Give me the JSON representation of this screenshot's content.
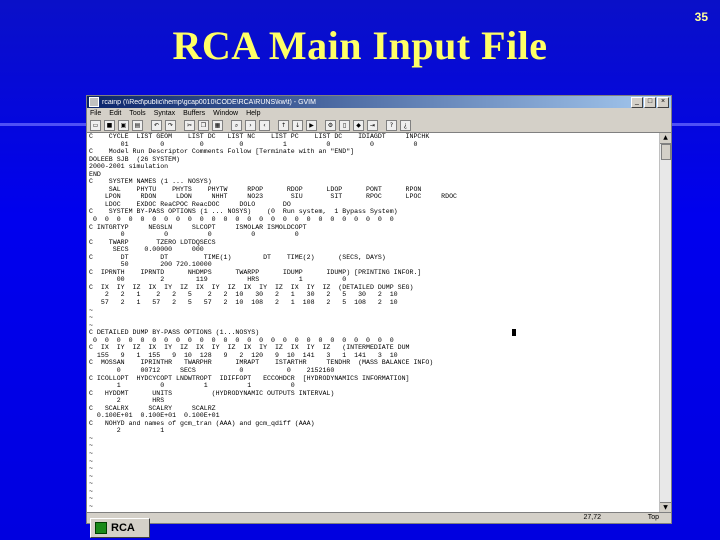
{
  "slide": {
    "title": "RCA Main Input File",
    "number": "35"
  },
  "window": {
    "title": "rcainp (\\\\Red\\public\\hemp\\gcap0010\\CODE\\RCA\\RUNS\\kw\\t) - GVIM",
    "controls": [
      "_",
      "□",
      "×"
    ]
  },
  "menu": [
    "File",
    "Edit",
    "Tools",
    "Syntax",
    "Buffers",
    "Window",
    "Help"
  ],
  "toolbar_icons": [
    "open-icon",
    "save-icon",
    "save-all-icon",
    "print-icon",
    "undo-icon",
    "redo-icon",
    "cut-icon",
    "copy-icon",
    "paste-icon",
    "find-icon",
    "find-next-icon",
    "find-prev-icon",
    "load-session-icon",
    "save-session-icon",
    "run-script-icon",
    "make-icon",
    "shell-icon",
    "run-ctags-icon",
    "jump-tag-icon",
    "help-icon",
    "find-help-icon"
  ],
  "editor_lines": [
    "C    CYCLE  LIST GEOM    LIST DC   LIST NC    LIST PC    LIST DC    IDIAGDT     INPCHK",
    "        01        0         0         0          1          0          0          0",
    "C    Model Run Descriptor Comments Follow [Terminate with an \"END\"]",
    "DOLEEB SJB  (26 SYSTEM)",
    "2000-2001 simulation",
    "END",
    "C    SYSTEM NAMES (1 ... NOSYS)",
    "     SAL    PHYTU    PHYTS    PHYTW     RPOP      RDOP      LDOP      PONT      RPON",
    "    LPON     RDON     LDON     NHHT     NO23       SIU       SIT      RPOC      LPOC     RDOC",
    "    LDOC    EXDOC ReaCPOC ReacDOC     DOLO       DO",
    "C    SYSTEM BY-PASS OPTIONS (1 ... NOSYS)    (0  Run system,  1 Bypass System)",
    " 0  0  0  0  0  0  0  0  0  0  0  0  0  0  0  0  0  0  0  0  0  0  0  0  0  0",
    "C INTGRTYP     NEGSLN     SLCOPT     ISMOLAR ISMOLDCOPT",
    "        0          0          0          0          0",
    "C    TWARP       TZERO LDTDQSECS",
    "      SECS    0.00000     000",
    "C       DT        DT         TIME(1)        DT    TIME(2)      (SECS, DAYS)",
    "        50        200 720.10000",
    "C  IPRNTH    IPRNTD      NHDMPS      TWARPP      IDUMP      IDUMP) [PRINTING INFOR.]",
    "       00         2        119          HRS          1          0",
    "C  IX  IY  IZ  IX  IY  IZ  IX  IY  IZ  IX  IY  IZ  IX  IY  IZ  (DETAILED DUMP SEG)",
    "    2   2   1    2   2   5    2   2  10   30   2   1   30   2   5   30   2  10",
    "   57   2   1   57   2   5   57   2  10  108   2   1  108   2   5  108   2  10",
    "~",
    "~",
    "~",
    "C DETAILED DUMP BY-PASS OPTIONS (1...NOSYS)",
    " 0  0  0  0  0  0  0  0  0  0  0  0  0  0  0  0  0  0  0  0  0  0  0  0  0  0",
    "C  IX  IY  IZ  IX  IY  IZ  IX  IY  IZ  IX  IY  IZ  IX  IY  IZ   (INTERMEDIATE DUM",
    "  155   9   1  155   9  10  128   9   2  120   9  10  141   3   1  141   3  10",
    "C  MOSSAN    IPRINTHR   TWARPHR      IMRAPT    ISTARTHR     TENDHR  (MASS BALANCE INFO)",
    "       0     00712     SECS           0           0    2152160",
    "C ICOLLOPT  HYDCYCOPT LNDWTROPT  IDIFFOPT   ECCOHDCR  [HYDRODYNAMICS INFORMATION]",
    "       1          0          1          1          0",
    "C   HYDDMT      UNITS          (HYDRODYNAMIC OUTPUTS INTERVAL)",
    "       2        HRS",
    "C   SCALRX     SCALRY     SCALRZ",
    "  0.100E+01  0.100E+01  0.100E+01",
    "C   NOHYD and names of gcm_tran (AAA) and gcm_qdiff (AAA)",
    "       2          1",
    "~",
    "~",
    "~",
    "~",
    "~",
    "~",
    "~",
    "~",
    "~",
    "~"
  ],
  "status": {
    "position": "27,72",
    "percent": "Top"
  },
  "taskbar": {
    "label": "RCA"
  }
}
